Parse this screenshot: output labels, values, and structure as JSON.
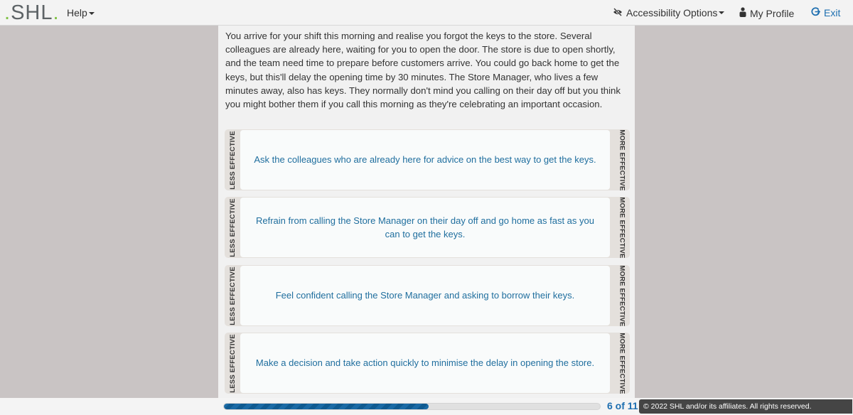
{
  "header": {
    "logo_text": "SHL",
    "help_label": "Help",
    "accessibility_label": "Accessibility Options",
    "profile_label": "My Profile",
    "exit_label": "Exit",
    "icons": {
      "accessibility": "low-vision-icon",
      "profile": "user-icon",
      "exit": "sign-out-icon"
    },
    "accent_color": "#1e6fb0",
    "logo_dot_color": "#7ec242"
  },
  "scenario": {
    "text": "You arrive for your shift this morning and realise you forgot the keys to the store. Several colleagues are already here, waiting for you to open the door. The store is due to open shortly, and the team need time to prepare before customers arrive. You could go back home to get the keys, but this'll delay the opening time by 30 minutes. The Store Manager, who lives a few minutes away, also has keys. They normally don't mind you calling on their day off but you think you might bother them if you call this morning as they're celebrating an important occasion."
  },
  "ranking": {
    "left_label": "LESS EFFECTIVE",
    "right_label": "MORE EFFECTIVE",
    "options": [
      {
        "text": "Ask the colleagues who are already here for advice on the best way to get the keys."
      },
      {
        "text": "Refrain from calling the Store Manager on their day off and go home as fast as you can to get the keys."
      },
      {
        "text": "Feel confident calling the Store Manager and asking to borrow their keys."
      },
      {
        "text": "Make a decision and take action quickly to minimise the delay in opening the store."
      }
    ]
  },
  "footer": {
    "progress_fraction": 0.545,
    "page_count": "6 of 11",
    "copyright": "© 2022 SHL and/or its affiliates. All rights reserved."
  }
}
